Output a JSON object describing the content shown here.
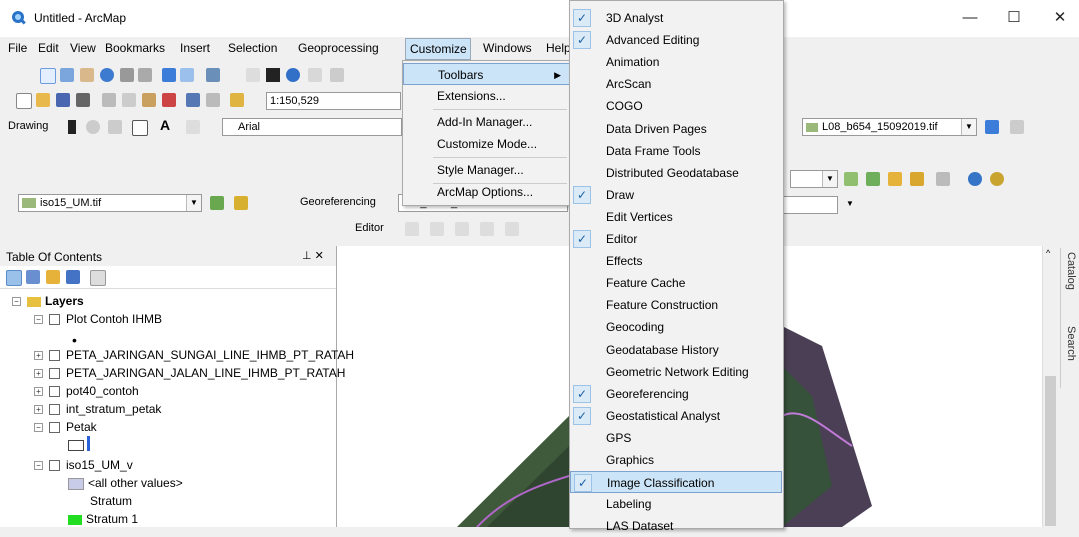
{
  "window": {
    "title": "Untitled - ArcMap",
    "controls": {
      "minimize": "—",
      "maximize": "☐",
      "close": "✕"
    }
  },
  "menubar": [
    "File",
    "Edit",
    "View",
    "Bookmarks",
    "Insert",
    "Selection",
    "Geoprocessing",
    "Customize",
    "Windows",
    "Help"
  ],
  "toolbar": {
    "scale": "1:150,529",
    "drawing_label": "Drawing",
    "font": "Arial",
    "layer_combo": "iso15_UM.tif",
    "georef_label": "Georeferencing",
    "georef_combo": "L08_b654_15092019.tif",
    "editor_label": "Editor",
    "right_combo": "L08_b654_15092019.tif"
  },
  "customize_menu": [
    "Toolbars",
    "Extensions...",
    "Add-In Manager...",
    "Customize Mode...",
    "Style Manager...",
    "ArcMap Options..."
  ],
  "toolbars_submenu": [
    {
      "label": "3D Analyst",
      "checked": true
    },
    {
      "label": "Advanced Editing",
      "checked": true
    },
    {
      "label": "Animation",
      "checked": false
    },
    {
      "label": "ArcScan",
      "checked": false
    },
    {
      "label": "COGO",
      "checked": false
    },
    {
      "label": "Data Driven Pages",
      "checked": false
    },
    {
      "label": "Data Frame Tools",
      "checked": false
    },
    {
      "label": "Distributed Geodatabase",
      "checked": false
    },
    {
      "label": "Draw",
      "checked": true
    },
    {
      "label": "Edit Vertices",
      "checked": false
    },
    {
      "label": "Editor",
      "checked": true
    },
    {
      "label": "Effects",
      "checked": false
    },
    {
      "label": "Feature Cache",
      "checked": false
    },
    {
      "label": "Feature Construction",
      "checked": false
    },
    {
      "label": "Geocoding",
      "checked": false
    },
    {
      "label": "Geodatabase History",
      "checked": false
    },
    {
      "label": "Geometric Network Editing",
      "checked": false
    },
    {
      "label": "Georeferencing",
      "checked": true
    },
    {
      "label": "Geostatistical Analyst",
      "checked": true
    },
    {
      "label": "GPS",
      "checked": false
    },
    {
      "label": "Graphics",
      "checked": false
    },
    {
      "label": "Image Classification",
      "checked": true,
      "highlighted": true
    },
    {
      "label": "Labeling",
      "checked": false
    },
    {
      "label": "LAS Dataset",
      "checked": false
    }
  ],
  "toc": {
    "title": "Table Of Contents",
    "pin": "⊥ ✕",
    "root": "Layers",
    "items": [
      {
        "label": "Plot Contoh IHMB",
        "expand": "−"
      },
      {
        "label": "•",
        "kind": "symbol"
      },
      {
        "label": "PETA_JARINGAN_SUNGAI_LINE_IHMB_PT_RATAH",
        "expand": "+"
      },
      {
        "label": "PETA_JARINGAN_JALAN_LINE_IHMB_PT_RATAH",
        "expand": "+"
      },
      {
        "label": "pot40_contoh",
        "expand": "+"
      },
      {
        "label": "int_stratum_petak",
        "expand": "+"
      },
      {
        "label": "Petak",
        "expand": "−"
      },
      {
        "label": "",
        "kind": "poly"
      },
      {
        "label": "iso15_UM_v",
        "expand": "−"
      },
      {
        "label": "<all other values>",
        "kind": "legend"
      },
      {
        "label": "Stratum",
        "kind": "heading"
      },
      {
        "label": "Stratum 1",
        "kind": "legend-green"
      }
    ]
  },
  "right_dock": [
    "Catalog",
    "Search"
  ],
  "colors": {
    "accent": "#cce4f7",
    "legend_green": "#22dd22",
    "legend_grey": "#c9cce8"
  }
}
